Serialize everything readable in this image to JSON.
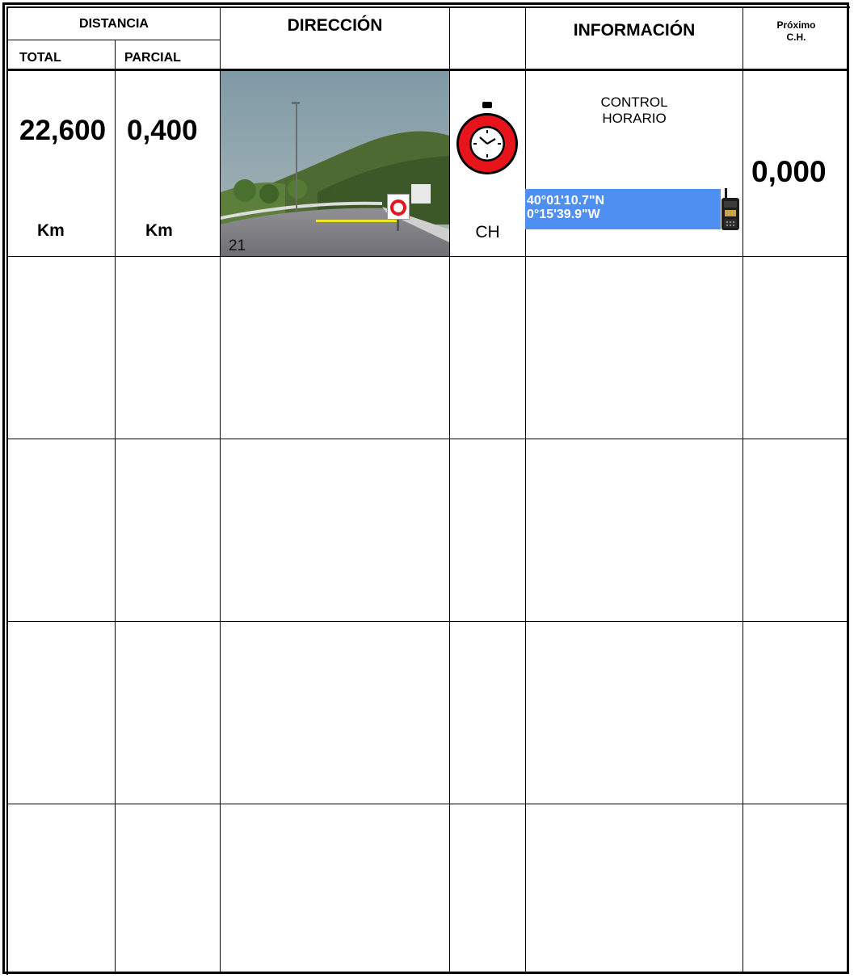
{
  "header": {
    "distancia": "DISTANCIA",
    "total": "TOTAL",
    "parcial": "PARCIAL",
    "direccion": "DIRECCIÓN",
    "informacion": "INFORMACIÓN",
    "proximo_line1": "Próximo",
    "proximo_line2": "C.H."
  },
  "row1": {
    "total_km": "22,600",
    "parcial_km": "0,400",
    "total_unit": "Km",
    "parcial_unit": "Km",
    "photo_number": "21",
    "symbol_label": "CH",
    "info_line1": "CONTROL",
    "info_line2": "HORARIO",
    "coord_lat": "40°01'10.7\"N",
    "coord_lon": "0°15'39.9\"W",
    "next_ch": "0,000"
  },
  "icons": {
    "stopwatch": "stopwatch-icon",
    "radio": "walkie-talkie-icon"
  },
  "colors": {
    "stopwatch_red": "#e8141b",
    "coord_bg": "#4f8ff1",
    "arrow_yellow": "#f3e326"
  }
}
